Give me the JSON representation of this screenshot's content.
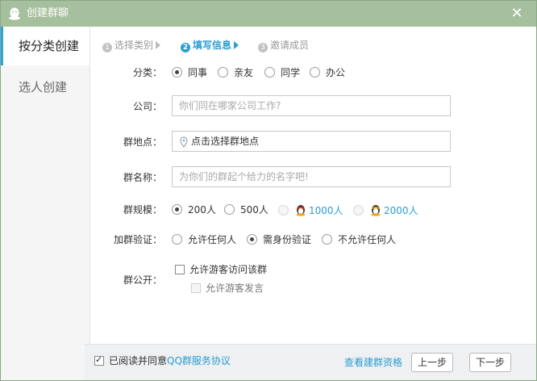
{
  "window": {
    "title": "创建群聊"
  },
  "sidebar": {
    "items": [
      {
        "label": "按分类创建"
      },
      {
        "label": "选人创建"
      }
    ]
  },
  "steps": [
    {
      "num": "1",
      "label": "选择类别"
    },
    {
      "num": "2",
      "label": "填写信息"
    },
    {
      "num": "3",
      "label": "邀请成员"
    }
  ],
  "form": {
    "category": {
      "label": "分类：",
      "options": [
        "同事",
        "亲友",
        "同学",
        "办公"
      ],
      "selected": "同事"
    },
    "company": {
      "label": "公司：",
      "placeholder": "你们同在哪家公司工作?"
    },
    "location": {
      "label": "群地点：",
      "placeholder": "点击选择群地点"
    },
    "name": {
      "label": "群名称：",
      "placeholder": "为你们的群起个给力的名字吧!"
    },
    "size": {
      "label": "群规模：",
      "options": [
        "200人",
        "500人",
        "1000人",
        "2000人"
      ],
      "selected": "200人"
    },
    "verify": {
      "label": "加群验证：",
      "options": [
        "允许任何人",
        "需身份验证",
        "不允许任何人"
      ],
      "selected": "需身份验证"
    },
    "public": {
      "label": "群公开：",
      "guest_visit": "允许游客访问该群",
      "guest_speak": "允许游客发言"
    }
  },
  "footer": {
    "agree_text": "已阅读并同意",
    "agree_link": "QQ群服务协议",
    "qualification_link": "查看建群资格",
    "prev_button": "上一步",
    "next_button": "下一步"
  },
  "colors": {
    "titlebar": "#a6bf9c",
    "accent": "#2a9dd3",
    "sidebar_bg": "#f5f5f5",
    "footer_bg": "#eef0f1"
  }
}
